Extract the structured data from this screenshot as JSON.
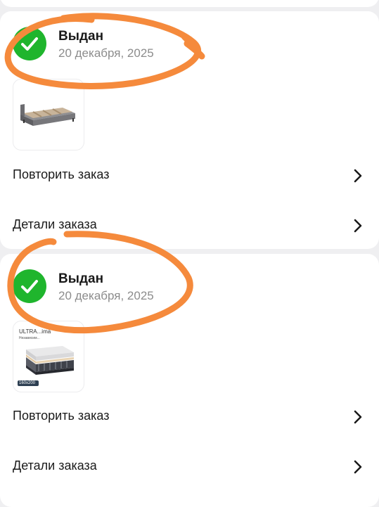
{
  "orders": [
    {
      "status": "Выдан",
      "date": "20 декабря, 2025",
      "thumbnail": "bed-frame",
      "actions": {
        "repeat": "Повторить заказ",
        "details": "Детали заказа"
      }
    },
    {
      "status": "Выдан",
      "date": "20 декабря, 2025",
      "thumbnail": "mattress",
      "thumb_brand": "ULTRA...ima",
      "thumb_subtitle": "Независим...",
      "thumb_size": "160x200",
      "actions": {
        "repeat": "Повторить заказ",
        "details": "Детали заказа"
      }
    }
  ],
  "colors": {
    "status_green": "#1fb52d",
    "annotation_orange": "#f58a3c",
    "background": "#efeff1"
  }
}
